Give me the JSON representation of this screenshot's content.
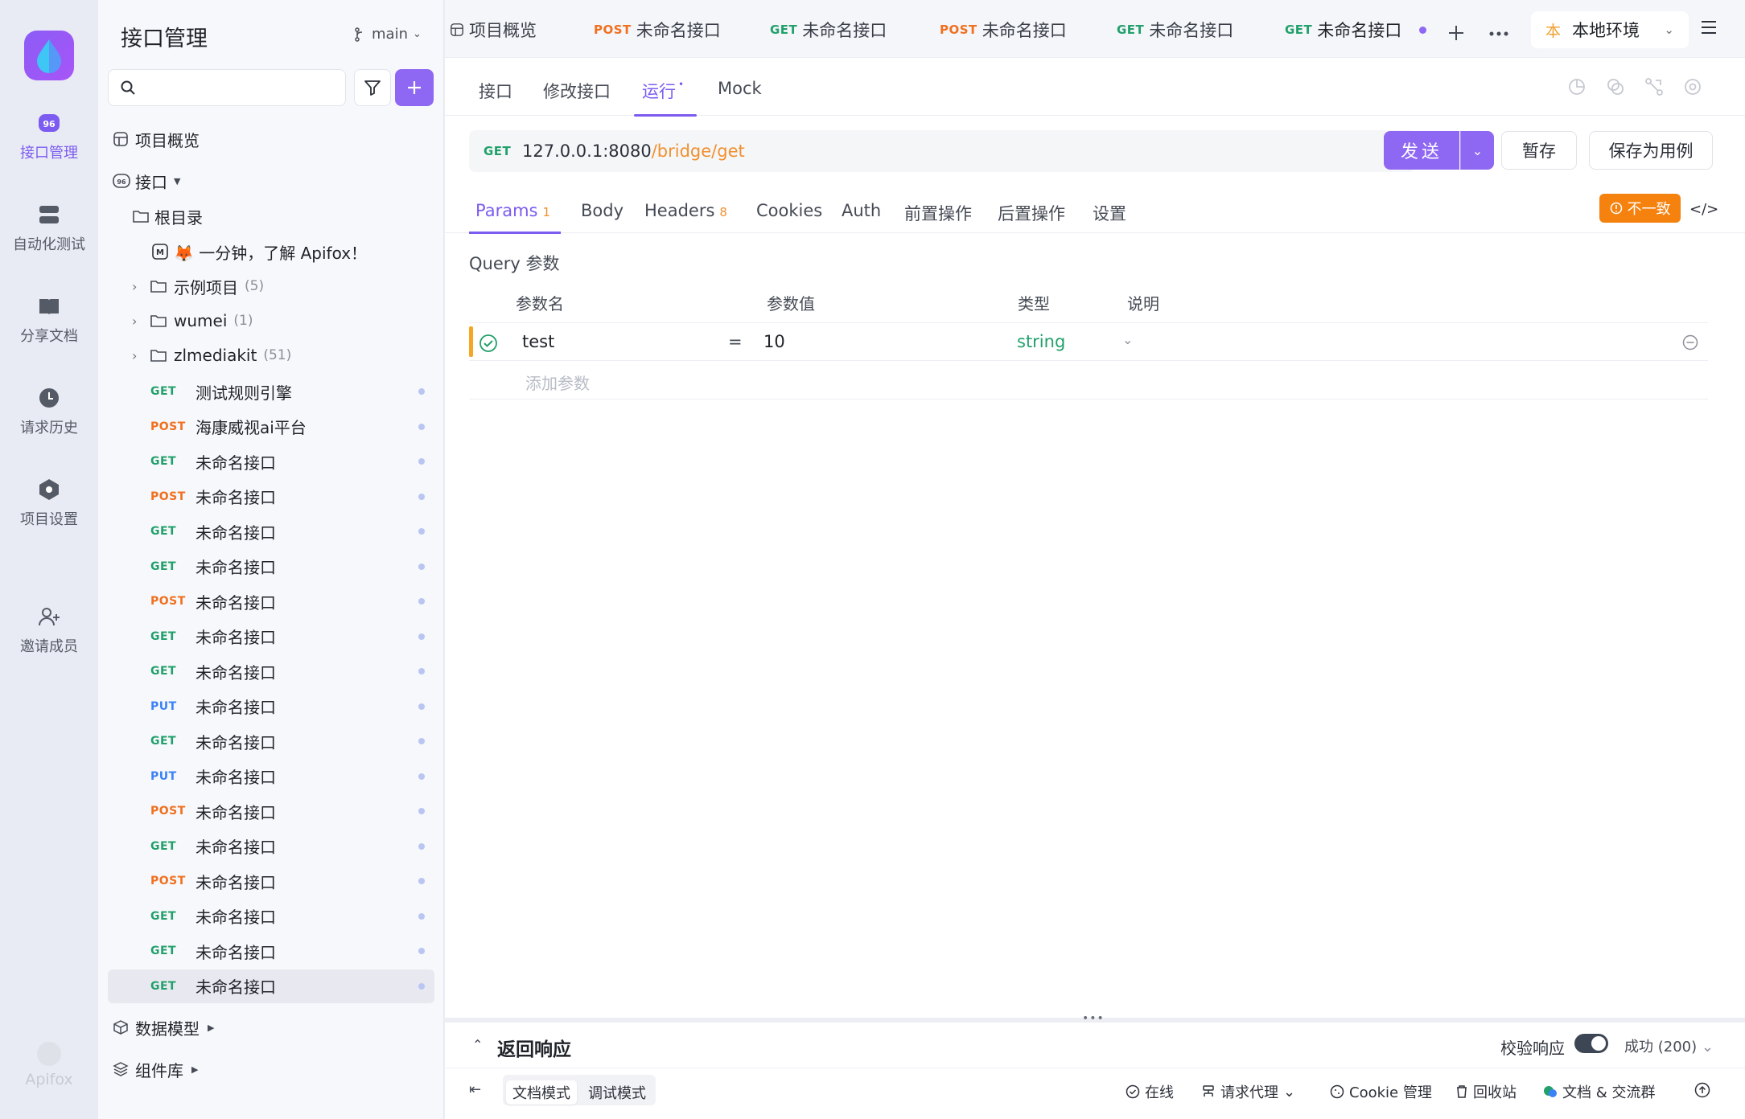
{
  "rail": {
    "items": [
      {
        "label": "接口管理",
        "icon": "api-icon"
      },
      {
        "label": "自动化测试",
        "icon": "automation-icon"
      },
      {
        "label": "分享文档",
        "icon": "book-icon"
      },
      {
        "label": "请求历史",
        "icon": "clock-icon"
      },
      {
        "label": "项目设置",
        "icon": "hexagon-icon"
      },
      {
        "label": "邀请成员",
        "icon": "add-user-icon"
      }
    ],
    "footer": "Apifox"
  },
  "sidebar": {
    "title": "接口管理",
    "branch": "main",
    "search_placeholder": "",
    "overview": "项目概览",
    "api_section": "接口",
    "root": "根目录",
    "intro_doc": "🦊 一分钟，了解 Apifox！",
    "folders": [
      {
        "name": "示例项目",
        "count": "(5)"
      },
      {
        "name": "wumei",
        "count": "(1)"
      },
      {
        "name": "zlmediakit",
        "count": "(51)"
      }
    ],
    "apis": [
      {
        "method": "GET",
        "name": "测试规则引擎"
      },
      {
        "method": "POST",
        "name": "海康威视ai平台"
      },
      {
        "method": "GET",
        "name": "未命名接口"
      },
      {
        "method": "POST",
        "name": "未命名接口"
      },
      {
        "method": "GET",
        "name": "未命名接口"
      },
      {
        "method": "GET",
        "name": "未命名接口"
      },
      {
        "method": "POST",
        "name": "未命名接口"
      },
      {
        "method": "GET",
        "name": "未命名接口"
      },
      {
        "method": "GET",
        "name": "未命名接口"
      },
      {
        "method": "PUT",
        "name": "未命名接口"
      },
      {
        "method": "GET",
        "name": "未命名接口"
      },
      {
        "method": "PUT",
        "name": "未命名接口"
      },
      {
        "method": "POST",
        "name": "未命名接口"
      },
      {
        "method": "GET",
        "name": "未命名接口"
      },
      {
        "method": "POST",
        "name": "未命名接口"
      },
      {
        "method": "GET",
        "name": "未命名接口"
      },
      {
        "method": "GET",
        "name": "未命名接口"
      },
      {
        "method": "GET",
        "name": "未命名接口"
      }
    ],
    "data_model": "数据模型",
    "components": "组件库"
  },
  "tabs": {
    "overview": "项目概览",
    "items": [
      {
        "method": "POST",
        "name": "未命名接口"
      },
      {
        "method": "GET",
        "name": "未命名接口"
      },
      {
        "method": "POST",
        "name": "未命名接口"
      },
      {
        "method": "GET",
        "name": "未命名接口"
      },
      {
        "method": "GET",
        "name": "未命名接口"
      }
    ],
    "env": "本地环境",
    "env_badge": "本"
  },
  "subtabs": [
    "接口",
    "修改接口",
    "运行",
    "Mock"
  ],
  "request": {
    "method": "GET",
    "host": "127.0.0.1:8080",
    "path": "/bridge/get",
    "send": "发送",
    "save_temp": "暂存",
    "save_case": "保存为用例"
  },
  "req_tabs": [
    {
      "label": "Params",
      "badge": "1"
    },
    {
      "label": "Body",
      "badge": ""
    },
    {
      "label": "Headers",
      "badge": "8"
    },
    {
      "label": "Cookies",
      "badge": ""
    },
    {
      "label": "Auth",
      "badge": ""
    },
    {
      "label": "前置操作",
      "badge": ""
    },
    {
      "label": "后置操作",
      "badge": ""
    },
    {
      "label": "设置",
      "badge": ""
    }
  ],
  "mismatch": "不一致",
  "query": {
    "label": "Query 参数",
    "headers": [
      "参数名",
      "参数值",
      "类型",
      "说明"
    ],
    "rows": [
      {
        "name": "test",
        "value": "10",
        "type": "string",
        "desc": ""
      }
    ],
    "add_placeholder": "添加参数"
  },
  "response": {
    "title": "返回响应",
    "validate": "校验响应",
    "status": "成功 (200)"
  },
  "statusbar": {
    "doc_mode": "文档模式",
    "debug_mode": "调试模式",
    "online": "在线",
    "proxy": "请求代理",
    "cookie": "Cookie 管理",
    "trash": "回收站",
    "community": "文档 & 交流群"
  },
  "colors": {
    "accent": "#8e67f2",
    "get": "#22a06b",
    "post": "#f0701f",
    "put": "#3b82f6",
    "warning": "#f5820f"
  }
}
